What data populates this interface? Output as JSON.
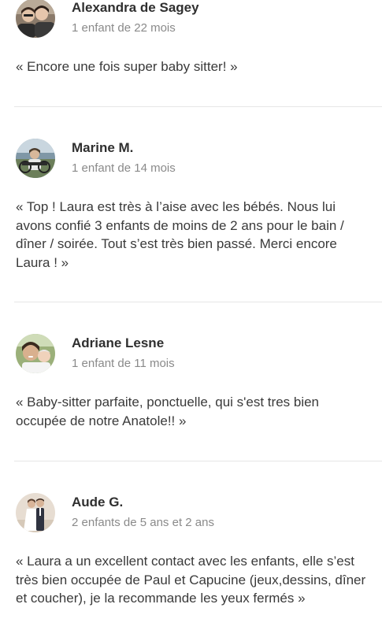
{
  "reviews": [
    {
      "name": "Alexandra de Sagey",
      "children": "1 enfant de 22 mois",
      "text": "« Encore une fois super baby sitter! »",
      "avatar_icon": "couple-photo-avatar"
    },
    {
      "name": "Marine M.",
      "children": "1 enfant de 14 mois",
      "text": "« Top ! Laura est très à l’aise avec les bébés. Nous lui avons confié 3 enfants de moins de 2 ans pour le bain / dîner / soirée. Tout s’est très bien passé. Merci encore Laura ! »",
      "avatar_icon": "outdoor-photo-avatar"
    },
    {
      "name": "Adriane Lesne",
      "children": "1 enfant de 11 mois",
      "text": "« Baby-sitter parfaite, ponctuelle, qui s'est tres bien occupée de notre Anatole!! »",
      "avatar_icon": "parent-child-photo-avatar"
    },
    {
      "name": "Aude G.",
      "children": "2 enfants de 5 ans et 2 ans",
      "text": "« Laura a un excellent contact avec les enfants, elle s’est très bien occupée de Paul et Capucine (jeux,dessins, dîner et coucher), je la recommande les yeux fermés »",
      "avatar_icon": "wedding-photo-avatar"
    }
  ]
}
